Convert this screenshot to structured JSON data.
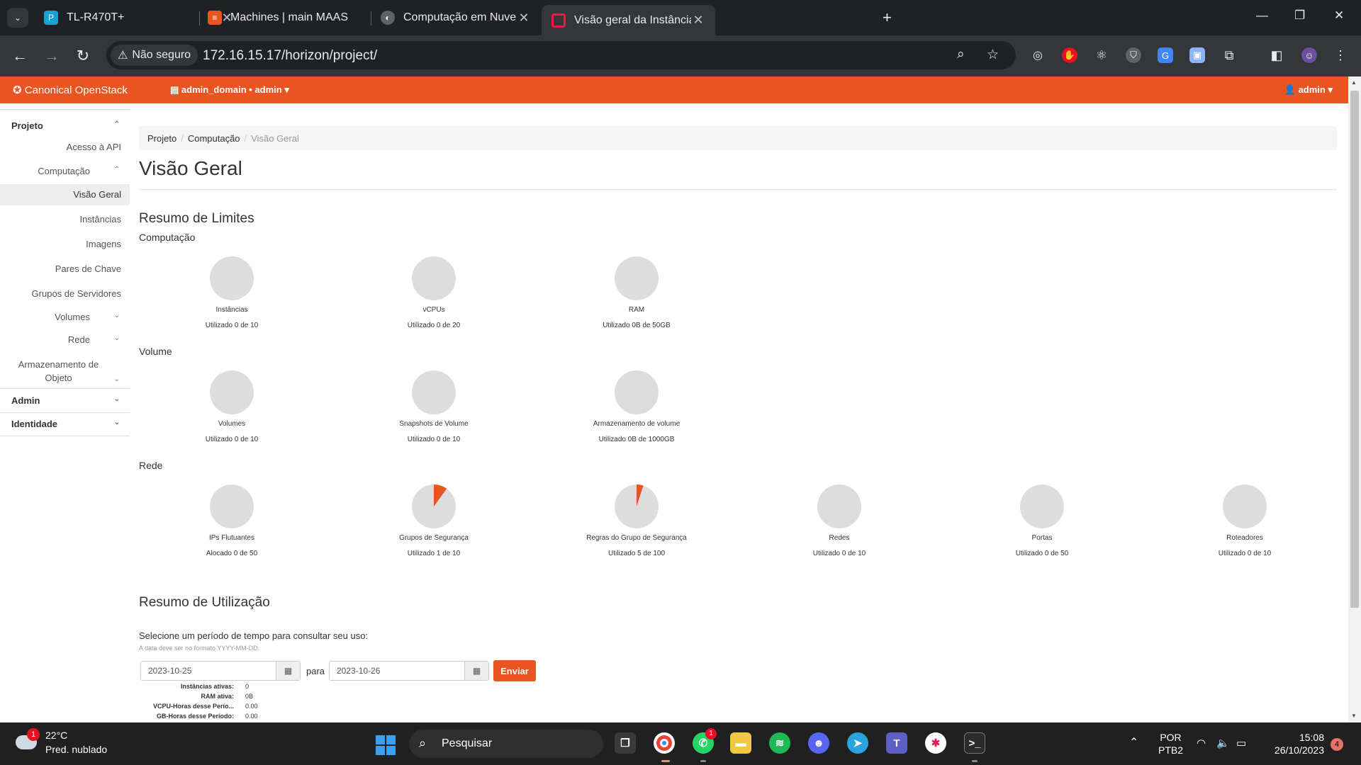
{
  "browser": {
    "tabs": [
      {
        "title": "TL-R470T+",
        "favicon": "tp-link-icon",
        "color": "#1ba1d6"
      },
      {
        "title": "Machines | main MAAS",
        "favicon": "maas-icon",
        "color": "#e95420"
      },
      {
        "title": "Computação em Nuvem - Com",
        "favicon": "book-icon",
        "color": "#5f6368"
      },
      {
        "title": "Visão geral da Instância - Oper",
        "favicon": "openstack-icon",
        "color": "#ed1944",
        "active": true
      }
    ],
    "security_label": "Não seguro",
    "url": "172.16.15.17/horizon/project/"
  },
  "navbar": {
    "brand": "Canonical OpenStack",
    "domain_selector": "admin_domain • admin",
    "user_menu": "admin",
    "color": "#e95420"
  },
  "sidebar": {
    "projeto": "Projeto",
    "acesso_api": "Acesso à API",
    "computacao": "Computação",
    "visao_geral": "Visão Geral",
    "instancias": "Instâncias",
    "imagens": "Imagens",
    "pares_chave": "Pares de Chave",
    "grupos_servidores": "Grupos de Servidores",
    "volumes": "Volumes",
    "rede": "Rede",
    "armazenamento_1": "Armazenamento de",
    "armazenamento_2": "Objeto",
    "admin": "Admin",
    "identidade": "Identidade"
  },
  "breadcrumb": {
    "item1": "Projeto",
    "item2": "Computação",
    "current": "Visão Geral"
  },
  "page_title": "Visão Geral",
  "limits": {
    "title": "Resumo de Limites",
    "groups": [
      {
        "title": "Computação",
        "items": [
          {
            "label": "Instâncias",
            "usage": "Utilizado 0 de 10",
            "used": 0,
            "total": 10
          },
          {
            "label": "vCPUs",
            "usage": "Utilizado 0 de 20",
            "used": 0,
            "total": 20
          },
          {
            "label": "RAM",
            "usage": "Utilizado 0B de 50GB",
            "used": 0,
            "total": 50
          }
        ]
      },
      {
        "title": "Volume",
        "items": [
          {
            "label": "Volumes",
            "usage": "Utilizado 0 de 10",
            "used": 0,
            "total": 10
          },
          {
            "label": "Snapshots de Volume",
            "usage": "Utilizado 0 de 10",
            "used": 0,
            "total": 10
          },
          {
            "label": "Armazenamento de volume",
            "usage": "Utilizado 0B de 1000GB",
            "used": 0,
            "total": 1000
          }
        ]
      },
      {
        "title": "Rede",
        "items": [
          {
            "label": "IPs Flutuantes",
            "usage": "Alocado 0 de 50",
            "used": 0,
            "total": 50
          },
          {
            "label": "Grupos de Segurança",
            "usage": "Utilizado 1 de 10",
            "used": 1,
            "total": 10
          },
          {
            "label": "Regras do Grupo de Segurança",
            "usage": "Utilizado 5 de 100",
            "used": 5,
            "total": 100
          },
          {
            "label": "Redes",
            "usage": "Utilizado 0 de 10",
            "used": 0,
            "total": 10
          },
          {
            "label": "Portas",
            "usage": "Utilizado 0 de 50",
            "used": 0,
            "total": 50
          },
          {
            "label": "Roteadores",
            "usage": "Utilizado 0 de 10",
            "used": 0,
            "total": 10
          }
        ]
      }
    ],
    "pie_bg": "#dddddd",
    "pie_fill": "#e95420"
  },
  "usage": {
    "title": "Resumo de Utilização",
    "prompt": "Selecione um período de tempo para consultar seu uso:",
    "hint": "A data deve ser no formato YYYY-MM-DD.",
    "start_date": "2023-10-25",
    "para": "para",
    "end_date": "2023-10-26",
    "submit": "Enviar",
    "stats": [
      {
        "label": "Instâncias ativas:",
        "value": "0"
      },
      {
        "label": "RAM ativa:",
        "value": "0B"
      },
      {
        "label": "VCPU-Horas desse Perío...",
        "value": "0.00"
      },
      {
        "label": "GB-Horas desse Período:",
        "value": "0.00"
      }
    ]
  },
  "taskbar": {
    "weather_badge": "1",
    "temperature": "22°C",
    "weather_desc": "Pred. nublado",
    "search_label": "Pesquisar",
    "whatsapp_badge": "1",
    "lang_1": "POR",
    "lang_2": "PTB2",
    "time": "15:08",
    "date": "26/10/2023",
    "notif_count": "4"
  }
}
